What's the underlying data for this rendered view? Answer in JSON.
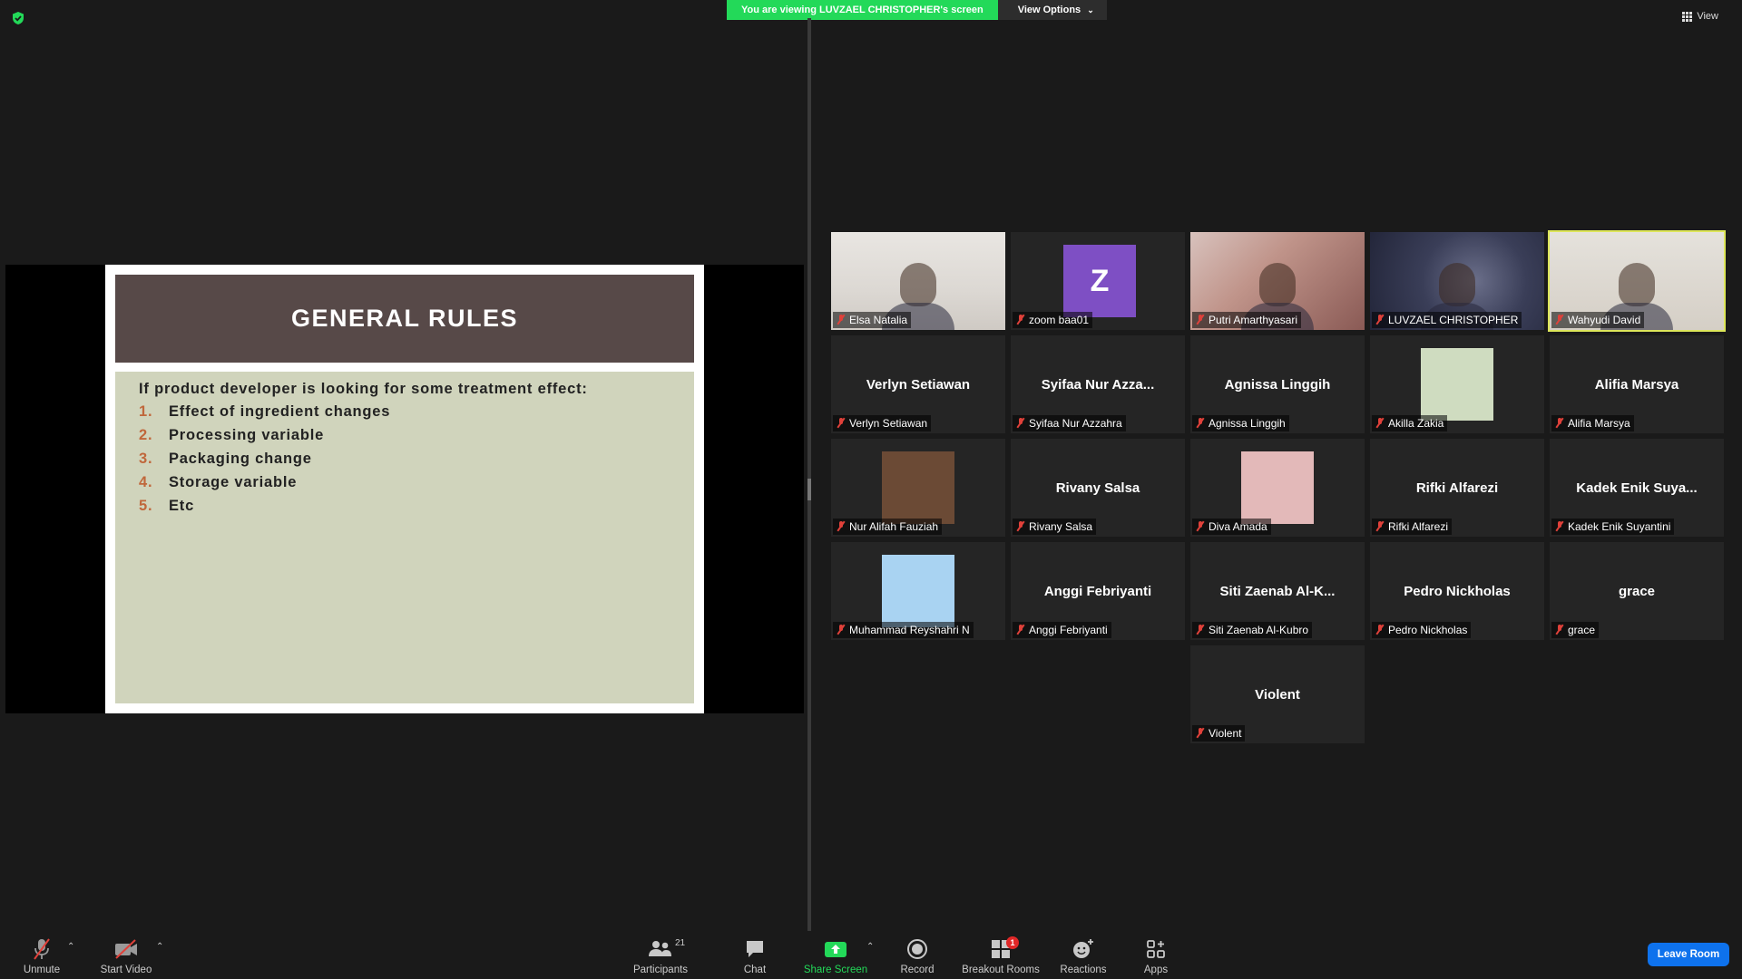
{
  "banner": {
    "viewing_text": "You are viewing LUVZAEL CHRISTOPHER's screen",
    "view_options": "View Options"
  },
  "top_right": {
    "view_label": "View"
  },
  "slide": {
    "title": "GENERAL RULES",
    "intro": "If product developer is looking for some treatment effect:",
    "items": [
      {
        "num": "1.",
        "text": "Effect of ingredient changes"
      },
      {
        "num": "2.",
        "text": "Processing variable"
      },
      {
        "num": "3.",
        "text": "Packaging change"
      },
      {
        "num": "4.",
        "text": "Storage variable"
      },
      {
        "num": "5.",
        "text": "Etc"
      }
    ]
  },
  "participants_grid": [
    {
      "label": "Elsa Natalia",
      "type": "video",
      "scene": "cam-elsa"
    },
    {
      "label": "zoom baa01",
      "type": "avatar",
      "letter": "Z"
    },
    {
      "label": "Putri Amarthyasari",
      "type": "video",
      "scene": "cam-putri"
    },
    {
      "label": "LUVZAEL CHRISTOPHER",
      "type": "video",
      "scene": "cam-luvzael"
    },
    {
      "label": "Wahyudi David",
      "type": "video",
      "scene": "cam-wahyudi",
      "active": true
    },
    {
      "label": "Verlyn Setiawan",
      "type": "name",
      "display": "Verlyn Setiawan"
    },
    {
      "label": "Syifaa Nur Azzahra",
      "type": "name",
      "display": "Syifaa Nur Azza..."
    },
    {
      "label": "Agnissa Linggih",
      "type": "name",
      "display": "Agnissa Linggih"
    },
    {
      "label": "Akilla Zakia",
      "type": "picture",
      "color": "#cfdcc0"
    },
    {
      "label": "Alifia Marsya",
      "type": "name",
      "display": "Alifia Marsya"
    },
    {
      "label": "Nur Alifah Fauziah",
      "type": "picture",
      "color": "#6b4a35"
    },
    {
      "label": "Rivany Salsa",
      "type": "name",
      "display": "Rivany Salsa"
    },
    {
      "label": "Diva Amada",
      "type": "picture",
      "color": "#e3b9b9"
    },
    {
      "label": "Rifki Alfarezi",
      "type": "name",
      "display": "Rifki Alfarezi"
    },
    {
      "label": "Kadek Enik Suyantini",
      "type": "name",
      "display": "Kadek Enik Suya..."
    },
    {
      "label": "Muhammad Reyshahri N",
      "type": "picture",
      "color": "#a9d3f2"
    },
    {
      "label": "Anggi Febriyanti",
      "type": "name",
      "display": "Anggi Febriyanti"
    },
    {
      "label": "Siti Zaenab Al-Kubro",
      "type": "name",
      "display": "Siti Zaenab Al-K..."
    },
    {
      "label": "Pedro Nickholas",
      "type": "name",
      "display": "Pedro Nickholas"
    },
    {
      "label": "grace",
      "type": "name",
      "display": "grace"
    },
    {
      "label": "Violent",
      "type": "name",
      "display": "Violent"
    }
  ],
  "toolbar": {
    "unmute": "Unmute",
    "start_video": "Start Video",
    "participants": "Participants",
    "participants_count": "21",
    "chat": "Chat",
    "share_screen": "Share Screen",
    "record": "Record",
    "breakout_rooms": "Breakout Rooms",
    "breakout_badge": "1",
    "reactions": "Reactions",
    "apps": "Apps",
    "leave_room": "Leave Room"
  },
  "colors": {
    "share_green": "#23d959",
    "leave_blue": "#0e72ed",
    "mic_off_red": "#e0413a",
    "active_speaker": "#dde65a",
    "slide_header": "#574948",
    "slide_body": "#d0d4bc",
    "slide_number": "#c0673b"
  }
}
